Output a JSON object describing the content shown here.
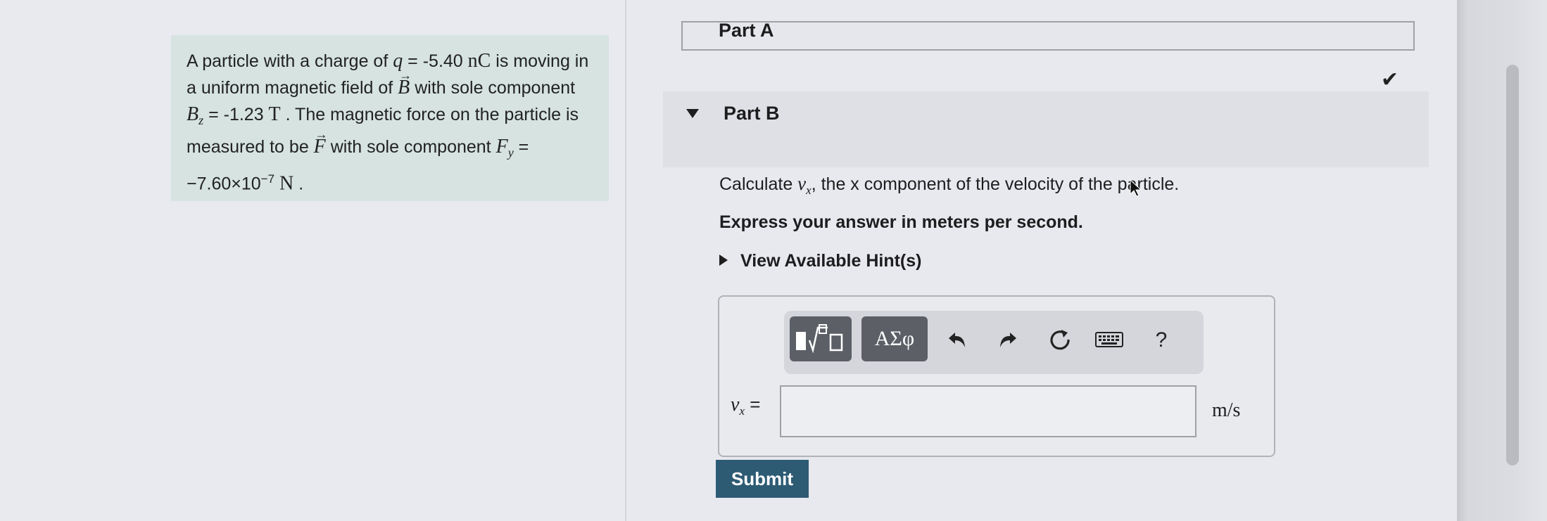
{
  "problem": {
    "s1": "A particle with a charge of ",
    "q_sym": "q",
    "q_eq": " = -5.40 ",
    "q_unit": "nC",
    "s2": " is moving in a uniform magnetic field of ",
    "B_sym": "B",
    "s3": " with sole component ",
    "Bz_sym": "B",
    "Bz_sub": "z",
    "Bz_eq": " = -1.23 ",
    "Bz_unit": "T",
    "s4": " . The magnetic force on the particle is measured to be ",
    "F_sym": "F",
    "s5": " with sole component ",
    "Fy_sym": "F",
    "Fy_sub": "y",
    "Fy_eq": " = −7.60×10",
    "Fy_exp": "−7",
    "Fy_unit": "N",
    "s6": " ."
  },
  "part_a": {
    "label": "Part A"
  },
  "part_b": {
    "label": "Part B"
  },
  "status": {
    "icon": "checkmark-icon"
  },
  "question": {
    "prefix": "Calculate ",
    "var": "v",
    "var_sub": "x",
    "suffix_before_cursor": ", the x component of the velocity of the p",
    "suffix_after_cursor": "article."
  },
  "express": "Express your answer in meters per second.",
  "hint": {
    "label": "View Available Hint(s)"
  },
  "toolbar": {
    "greek_label": "ΑΣφ",
    "help_label": "?",
    "icons": [
      "templates-icon",
      "undo-icon",
      "redo-icon",
      "reset-icon",
      "keyboard-icon",
      "help-icon"
    ]
  },
  "answer": {
    "var": "v",
    "var_sub": "x",
    "equals": " =",
    "value": "",
    "unit": "m/s"
  },
  "submit": {
    "label": "Submit"
  },
  "colors": {
    "problem_bg": "#d6e3e1",
    "submit_bg": "#2d5b74",
    "toolbar_dark": "#5c5f66"
  }
}
